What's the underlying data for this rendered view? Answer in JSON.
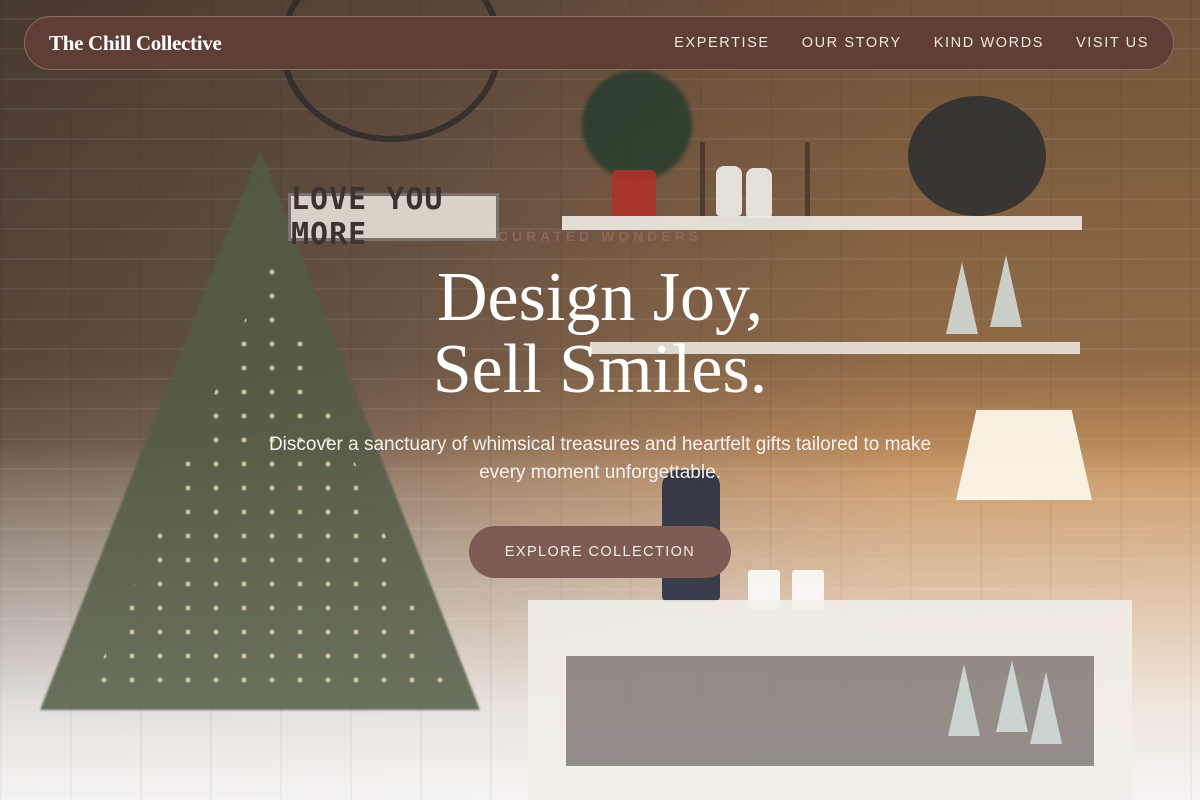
{
  "brand": "The Chill Collective",
  "nav": {
    "items": [
      "EXPERTISE",
      "OUR STORY",
      "KIND WORDS",
      "VISIT US"
    ]
  },
  "hero": {
    "eyebrow": "CURATED WONDERS",
    "headline_line1": "Design Joy,",
    "headline_line2": "Sell Smiles.",
    "subtext": "Discover a sanctuary of whimsical treasures and heartfelt gifts tailored to make every moment unforgettable.",
    "cta_label": "EXPLORE COLLECTION",
    "background_sign_text": "LOVE YOU MORE"
  },
  "colors": {
    "nav_background": "#5e3e35",
    "cta_background": "#7e5b55",
    "headline_text": "#ffffff"
  }
}
